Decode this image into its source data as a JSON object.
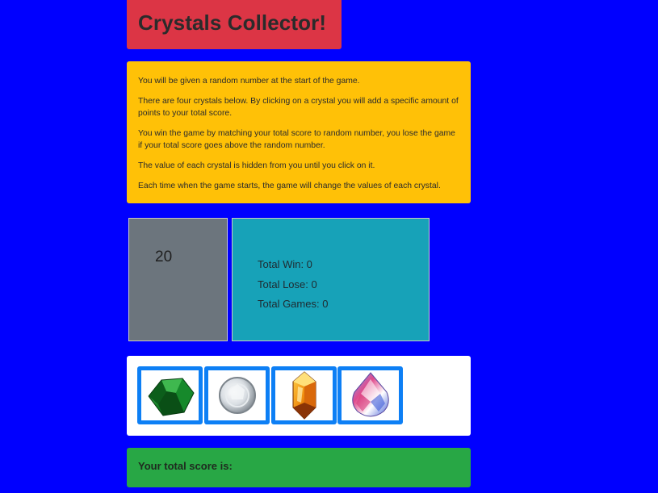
{
  "header": {
    "title": "Crystals Collector!"
  },
  "instructions": [
    "You will be given a random number at the start of the game.",
    "There are four crystals below. By clicking on a crystal you will add a specific amount of points to your total score.",
    "You win the game by matching your total score to random number, you lose the game if your total score goes above the random number.",
    "The value of each crystal is hidden from you until you click on it.",
    "Each time when the game starts, the game will change the values of each crystal."
  ],
  "random_number": "20",
  "stats": {
    "wins": "Total Win: 0",
    "losses": "Total Lose: 0",
    "games": "Total Games: 0"
  },
  "crystals": [
    {
      "icon": "green-emerald-crystal-icon"
    },
    {
      "icon": "white-diamond-crystal-icon"
    },
    {
      "icon": "amber-crystal-icon"
    },
    {
      "icon": "rainbow-teardrop-crystal-icon"
    }
  ],
  "score": {
    "label": "Your total score is:"
  },
  "colors": {
    "background": "#0000ff",
    "title_bg": "#dc3545",
    "instructions_bg": "#ffc107",
    "random_bg": "#6c757d",
    "stats_bg": "#17a2b8",
    "crystal_border": "#0d7ff5",
    "score_bg": "#28a745"
  }
}
